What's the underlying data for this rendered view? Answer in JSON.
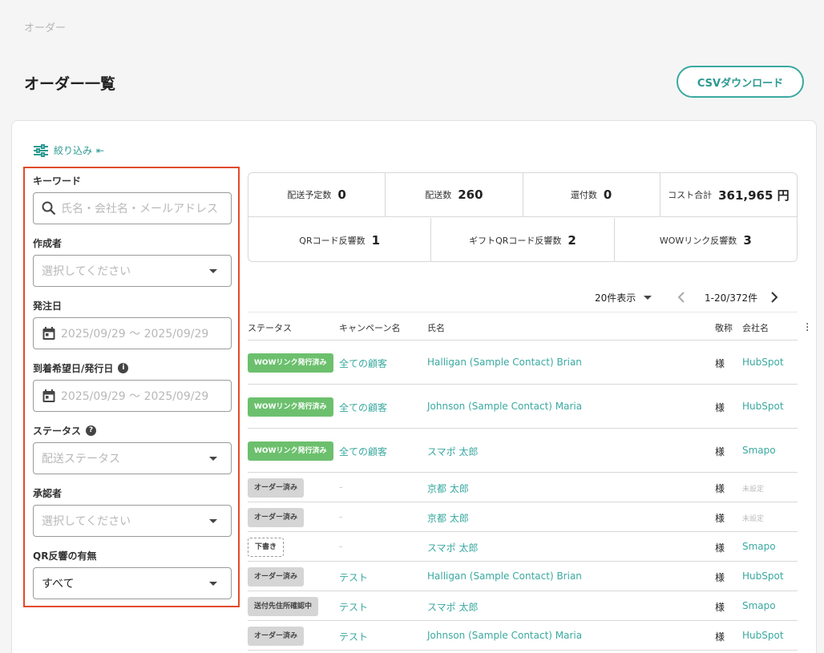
{
  "breadcrumb": "オーダー",
  "page_title": "オーダー一覧",
  "csv_button": "CSVダウンロード",
  "filter": {
    "toggle_label": "絞り込み",
    "collapse_glyph": "⇤",
    "keyword_label": "キーワード",
    "keyword_placeholder": "氏名・会社名・メールアドレス",
    "creator_label": "作成者",
    "creator_placeholder": "選択してください",
    "order_date_label": "発注日",
    "order_date_value": "2025/09/29 〜 2025/09/29",
    "arrival_date_label": "到着希望日/発行日",
    "arrival_date_value": "2025/09/29 〜 2025/09/29",
    "status_label": "ステータス",
    "status_placeholder": "配送ステータス",
    "approver_label": "承認者",
    "approver_placeholder": "選択してください",
    "qr_label": "QR反響の有無",
    "qr_value": "すべて"
  },
  "stats": {
    "row1": [
      {
        "label": "配送予定数",
        "value": "0"
      },
      {
        "label": "配送数",
        "value": "260"
      },
      {
        "label": "還付数",
        "value": "0"
      },
      {
        "label": "コスト合計",
        "value": "361,965 円"
      }
    ],
    "row2": [
      {
        "label": "QRコード反響数",
        "value": "1"
      },
      {
        "label": "ギフトQRコード反響数",
        "value": "2"
      },
      {
        "label": "WOWリンク反響数",
        "value": "3"
      }
    ]
  },
  "pagination": {
    "per_page": "20件表示",
    "range": "1-20/372件"
  },
  "table": {
    "headers": {
      "status": "ステータス",
      "campaign": "キャンペーン名",
      "name": "氏名",
      "honorific": "敬称",
      "company": "会社名"
    },
    "rows": [
      {
        "status": "WOWリンク発行済み",
        "campaign": "全ての顧客",
        "name": "Halligan (Sample Contact) Brian",
        "honorific": "様",
        "company": "HubSpot"
      },
      {
        "status": "WOWリンク発行済み",
        "campaign": "全ての顧客",
        "name": "Johnson (Sample Contact) Maria",
        "honorific": "様",
        "company": "HubSpot"
      },
      {
        "status": "WOWリンク発行済み",
        "campaign": "全ての顧客",
        "name": "スマポ 太郎",
        "honorific": "様",
        "company": "Smapo"
      },
      {
        "status": "オーダー済み",
        "campaign": "-",
        "name": "京都 太郎",
        "honorific": "様",
        "company": "未設定"
      },
      {
        "status": "オーダー済み",
        "campaign": "-",
        "name": "京都 太郎",
        "honorific": "様",
        "company": "未設定"
      },
      {
        "status": "下書き",
        "campaign": "-",
        "name": "スマポ 太郎",
        "honorific": "様",
        "company": "Smapo"
      },
      {
        "status": "オーダー済み",
        "campaign": "テスト",
        "name": "Halligan (Sample Contact) Brian",
        "honorific": "様",
        "company": "HubSpot"
      },
      {
        "status": "送付先住所確認中",
        "campaign": "テスト",
        "name": "スマポ 太郎",
        "honorific": "様",
        "company": "Smapo"
      },
      {
        "status": "オーダー済み",
        "campaign": "テスト",
        "name": "Johnson (Sample Contact) Maria",
        "honorific": "様",
        "company": "HubSpot"
      }
    ]
  },
  "colors": {
    "accent": "#3aa9a0",
    "badge_green": "#6cc06d",
    "badge_gray": "#d5d5d5",
    "highlight_border": "#e24a2b"
  }
}
